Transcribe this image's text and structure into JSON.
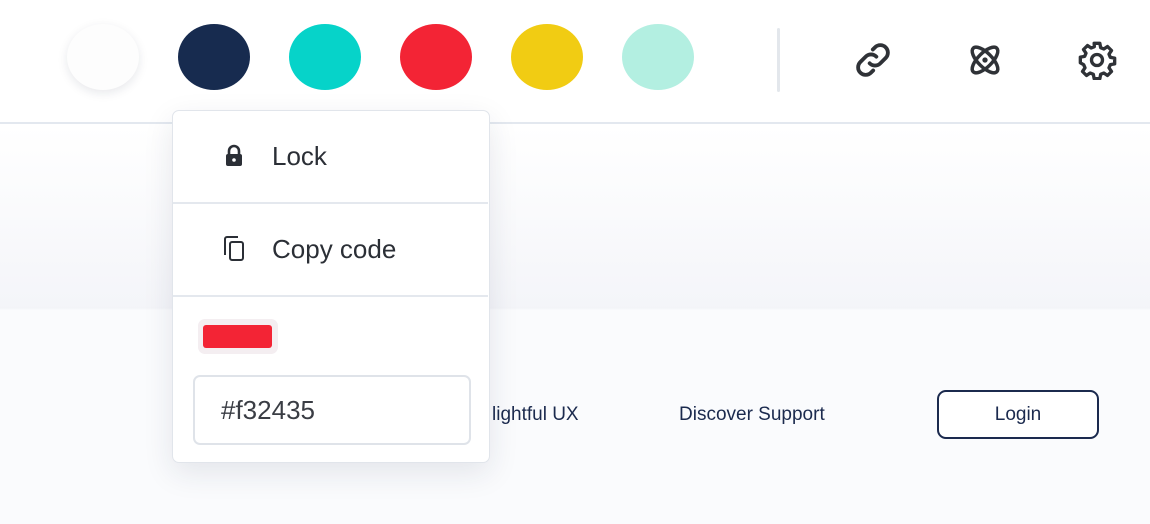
{
  "palette": {
    "swatches": [
      {
        "name": "white",
        "color": "#fdfdfd"
      },
      {
        "name": "navy",
        "color": "#172b4f"
      },
      {
        "name": "teal",
        "color": "#06d3c9"
      },
      {
        "name": "red",
        "color": "#f32435"
      },
      {
        "name": "yellow",
        "color": "#f1cc13"
      },
      {
        "name": "mint",
        "color": "#b3efe1"
      }
    ],
    "tools": [
      "link-icon",
      "atom-icon",
      "gear-icon"
    ]
  },
  "popup": {
    "lock_label": "Lock",
    "copy_label": "Copy code",
    "selected_color": "#f32435",
    "hex_value": "#f32435"
  },
  "preview": {
    "nav_links": [
      "lightful UX",
      "Discover Support"
    ],
    "login_label": "Login"
  },
  "colors": {
    "text_dark": "#1b2a4e",
    "border": "#e1e5eb"
  }
}
